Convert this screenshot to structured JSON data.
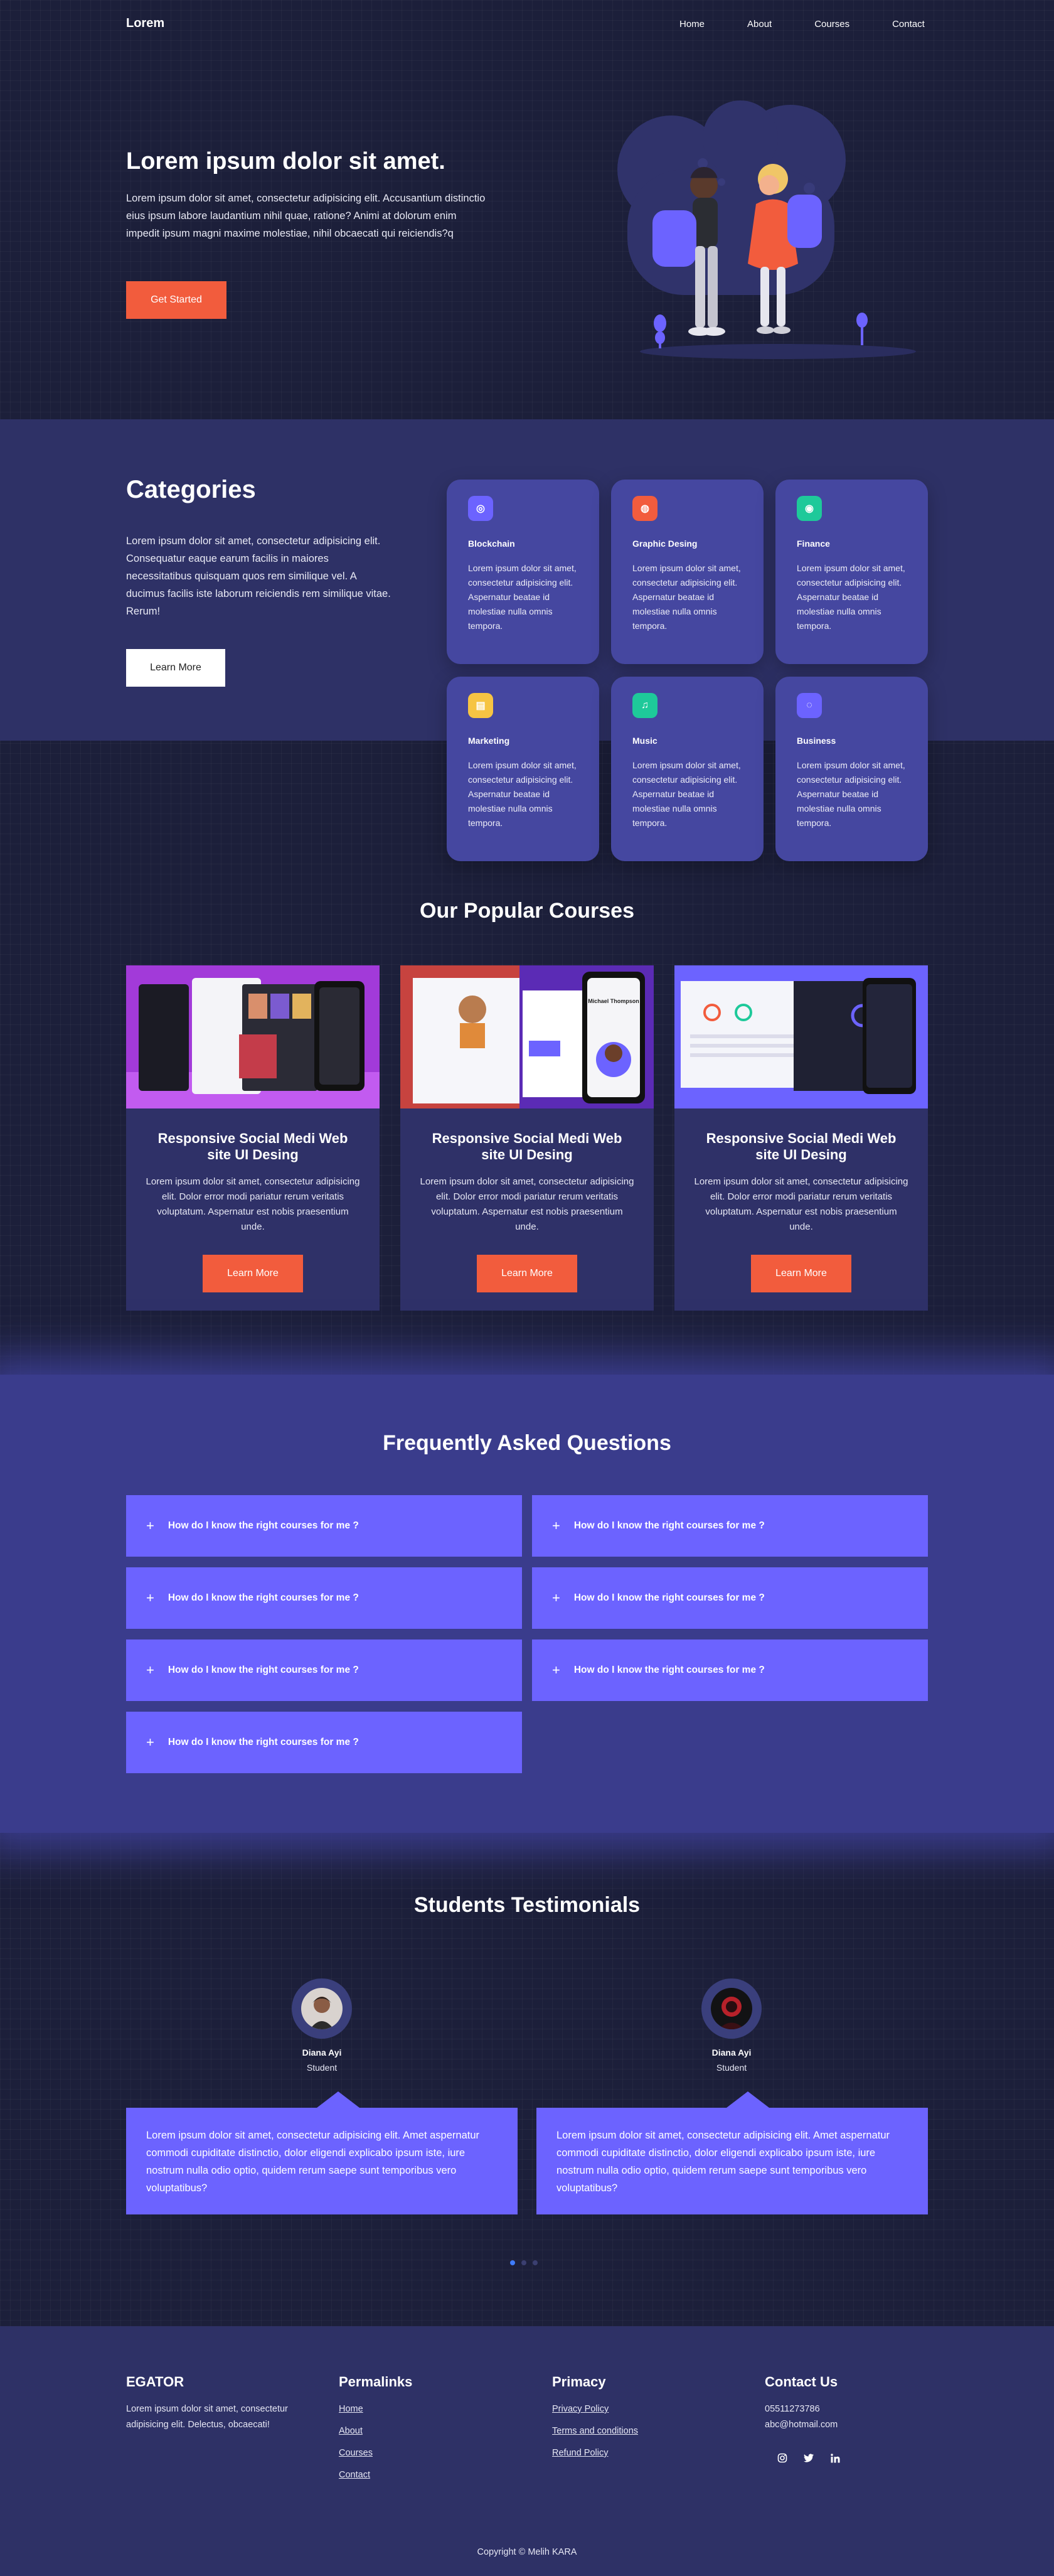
{
  "nav": {
    "brand": "Lorem",
    "links": [
      "Home",
      "About",
      "Courses",
      "Contact"
    ]
  },
  "hero": {
    "title": "Lorem ipsum dolor sit amet.",
    "text": "Lorem ipsum dolor sit amet, consectetur adipisicing elit. Accusantium distinctio eius ipsum labore laudantium nihil quae, ratione? Animi at dolorum enim impedit ipsum magni maxime molestiae, nihil obcaecati qui reiciendis?q",
    "button": "Get Started"
  },
  "categories": {
    "title": "Categories",
    "text": "Lorem ipsum dolor sit amet, consectetur adipisicing elit. Consequatur eaque earum facilis in maiores necessitatibus quisquam quos rem similique vel. A ducimus facilis iste laborum reiciendis rem similique vitae. Rerum!",
    "button": "Learn More",
    "items": [
      {
        "name": "Blockchain",
        "icon": "bitcoin-icon",
        "color": "#6c63ff",
        "glyph": "◎",
        "desc": "Lorem ipsum dolor sit amet, consectetur adipisicing elit. Aspernatur beatae id molestiae nulla omnis tempora."
      },
      {
        "name": "Graphic Desing",
        "icon": "palette-icon",
        "color": "#f25c3d",
        "glyph": "◍",
        "desc": "Lorem ipsum dolor sit amet, consectetur adipisicing elit. Aspernatur beatae id molestiae nulla omnis tempora."
      },
      {
        "name": "Finance",
        "icon": "dollar-icon",
        "color": "#1ec99a",
        "glyph": "◉",
        "desc": "Lorem ipsum dolor sit amet, consectetur adipisicing elit. Aspernatur beatae id molestiae nulla omnis tempora."
      },
      {
        "name": "Marketing",
        "icon": "chart-icon",
        "color": "#f6c443",
        "glyph": "▤",
        "desc": "Lorem ipsum dolor sit amet, consectetur adipisicing elit. Aspernatur beatae id molestiae nulla omnis tempora."
      },
      {
        "name": "Music",
        "icon": "music-icon",
        "color": "#1ec99a",
        "glyph": "♫",
        "desc": "Lorem ipsum dolor sit amet, consectetur adipisicing elit. Aspernatur beatae id molestiae nulla omnis tempora."
      },
      {
        "name": "Business",
        "icon": "briefcase-icon",
        "color": "#6c63ff",
        "glyph": "◌",
        "desc": "Lorem ipsum dolor sit amet, consectetur adipisicing elit. Aspernatur beatae id molestiae nulla omnis tempora."
      }
    ]
  },
  "courses": {
    "title": "Our Popular Courses",
    "items": [
      {
        "title": "Responsive Social Medi Web site UI Desing",
        "desc": "Lorem ipsum dolor sit amet, consectetur adipisicing elit. Dolor error modi pariatur rerum veritatis voluptatum. Aspernatur est nobis praesentium unde.",
        "button": "Learn More"
      },
      {
        "title": "Responsive Social Medi Web site UI Desing",
        "desc": "Lorem ipsum dolor sit amet, consectetur adipisicing elit. Dolor error modi pariatur rerum veritatis voluptatum. Aspernatur est nobis praesentium unde.",
        "button": "Learn More",
        "mockup_heading": "Michael Thompson"
      },
      {
        "title": "Responsive Social Medi Web site UI Desing",
        "desc": "Lorem ipsum dolor sit amet, consectetur adipisicing elit. Dolor error modi pariatur rerum veritatis voluptatum. Aspernatur est nobis praesentium unde.",
        "button": "Learn More"
      }
    ]
  },
  "faq": {
    "title": "Frequently Asked Questions",
    "questions": [
      "How do I know the right courses for me ?",
      "How do I know the right courses for me ?",
      "How do I know the right courses for me ?",
      "How do I know the right courses for me ?",
      "How do I know the right courses for me ?",
      "How do I know the right courses for me ?",
      "How do I know the right courses for me ?"
    ]
  },
  "testimonials": {
    "title": "Students Testimonials",
    "items": [
      {
        "name": "Diana Ayi",
        "role": "Student",
        "text": "Lorem ipsum dolor sit amet, consectetur adipisicing elit. Amet aspernatur commodi cupiditate distinctio, dolor eligendi explicabo ipsum iste, iure nostrum nulla odio optio, quidem rerum saepe sunt temporibus vero voluptatibus?"
      },
      {
        "name": "Diana Ayi",
        "role": "Student",
        "text": "Lorem ipsum dolor sit amet, consectetur adipisicing elit. Amet aspernatur commodi cupiditate distinctio, dolor eligendi explicabo ipsum iste, iure nostrum nulla odio optio, quidem rerum saepe sunt temporibus vero voluptatibus?"
      }
    ],
    "active_dot": 0
  },
  "footer": {
    "brand": "EGATOR",
    "brand_text": "Lorem ipsum dolor sit amet, consectetur adipisicing elit. Delectus, obcaecati!",
    "permalinks_title": "Permalinks",
    "permalinks": [
      "Home",
      "About",
      "Courses",
      "Contact"
    ],
    "primacy_title": "Primacy",
    "primacy": [
      "Privacy Policy",
      "Terms and conditions",
      "Refund Policy"
    ],
    "contact_title": "Contact Us",
    "phone": "05511273786",
    "email": "abc@hotmail.com",
    "social": [
      "instagram-icon",
      "twitter-icon",
      "linkedin-icon"
    ],
    "copyright": "Copyright © Melih KARA"
  },
  "colors": {
    "background": "#1c1f3a",
    "band": "#2e3166",
    "accent": "#6c63ff",
    "orange": "#f25c3d"
  }
}
